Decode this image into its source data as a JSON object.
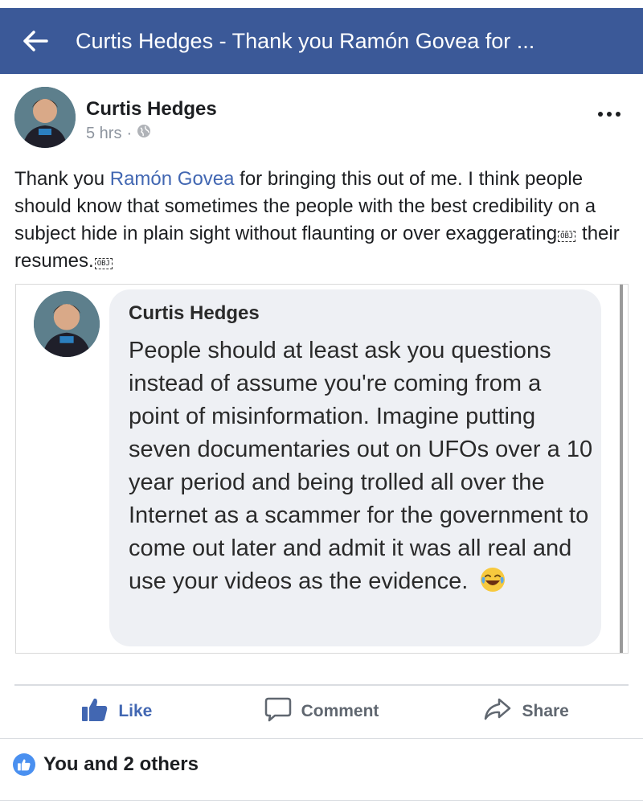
{
  "header": {
    "title": "Curtis Hedges - Thank you Ramón Govea for ..."
  },
  "post": {
    "author": "Curtis Hedges",
    "time": "5 hrs",
    "separator": "·",
    "text_part1": "Thank you ",
    "mention": "Ramón Govea",
    "text_part2": " for bringing this out of me. I think people should know that sometimes the people with the best credibility on a subject hide in plain sight without flaunting or over exaggerating",
    "obj_marker": "OBJ",
    "text_part3": " their resumes."
  },
  "shared_image": {
    "author": "Curtis Hedges",
    "text": "People should at least ask you questions instead of assume you're coming from a point of misinformation. Imagine putting seven documentaries out on UFOs over a 10 year period and being trolled all over the Internet as a scammer for the government to come out later and admit it was all real and use your videos as the evidence."
  },
  "actions": {
    "like": "Like",
    "comment": "Comment",
    "share": "Share"
  },
  "reactions": {
    "summary": "You and 2 others"
  },
  "colors": {
    "header_bg": "#3b5998",
    "link": "#4267b2",
    "muted": "#8d949e",
    "action_text": "#606770"
  }
}
